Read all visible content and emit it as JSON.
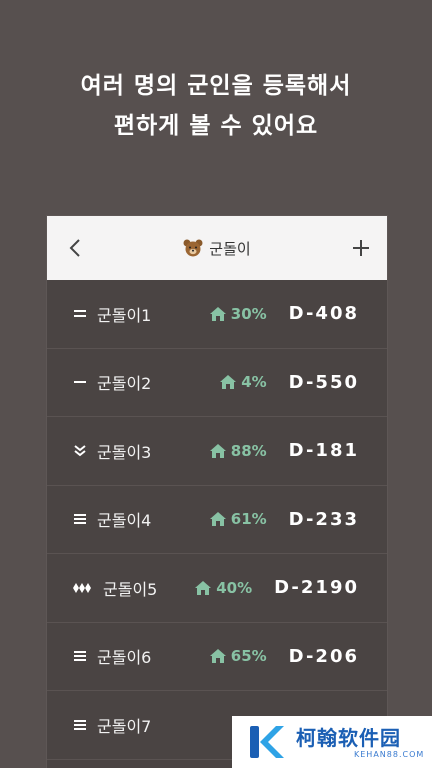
{
  "headline": {
    "line1": "여러 명의 군인을 등록해서",
    "line2": "편하게 볼 수 있어요"
  },
  "appbar": {
    "title": "군돌이",
    "title_icon": "bear-face-icon",
    "back_icon": "chevron-left-icon",
    "add_icon": "plus-icon"
  },
  "soldiers": [
    {
      "name": "군돌이1",
      "rank_icon": "rank-two-bars-icon",
      "percent": "30%",
      "dday": "D-408"
    },
    {
      "name": "군돌이2",
      "rank_icon": "rank-one-bar-icon",
      "percent": "4%",
      "dday": "D-550"
    },
    {
      "name": "군돌이3",
      "rank_icon": "rank-chevron-icon",
      "percent": "88%",
      "dday": "D-181"
    },
    {
      "name": "군돌이4",
      "rank_icon": "rank-three-bars-icon",
      "percent": "61%",
      "dday": "D-233"
    },
    {
      "name": "군돌이5",
      "rank_icon": "rank-diamonds-icon",
      "percent": "40%",
      "dday": "D-2190"
    },
    {
      "name": "군돌이6",
      "rank_icon": "rank-three-bars-icon",
      "percent": "65%",
      "dday": "D-206"
    },
    {
      "name": "군돌이7",
      "rank_icon": "rank-three-bars-icon",
      "percent": "",
      "dday": ""
    }
  ],
  "watermark": {
    "main": "柯翰软件园",
    "sub": "KEHAN88.COM"
  },
  "colors": {
    "background": "#57504f",
    "list_background": "#4a4443",
    "accent_green": "#88c2a4",
    "watermark_blue": "#1b5fb4"
  }
}
